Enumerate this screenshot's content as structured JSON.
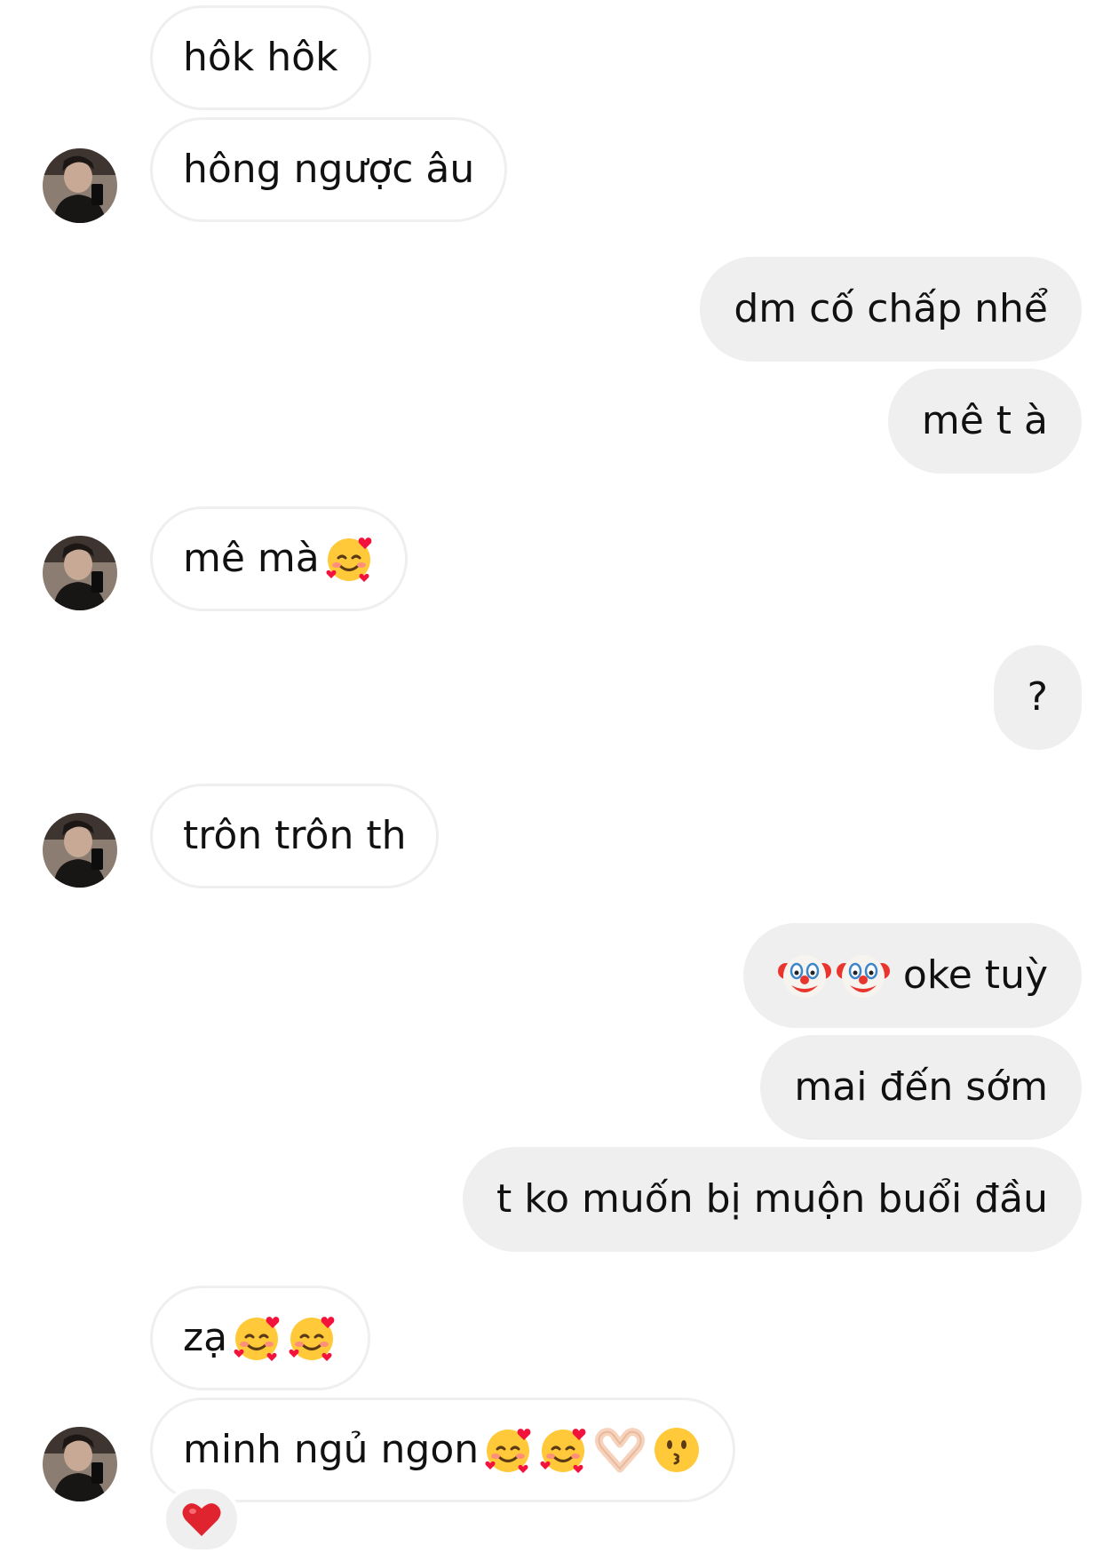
{
  "messages": [
    {
      "side": "in",
      "text": "hôk hôk",
      "emoji": []
    },
    {
      "side": "in",
      "text": "hông ngược âu",
      "emoji": []
    },
    {
      "side": "out",
      "text": "dm cố chấp nhể",
      "emoji": []
    },
    {
      "side": "out",
      "text": "mê t à",
      "emoji": []
    },
    {
      "side": "in",
      "text": "mê mà",
      "emoji": [
        "smiling-face-with-hearts-icon"
      ]
    },
    {
      "side": "out",
      "text": "?",
      "emoji": []
    },
    {
      "side": "in",
      "text": "trôn trôn th",
      "emoji": []
    },
    {
      "side": "out",
      "text": "oke tuỳ",
      "emoji": [
        "clown-face-icon",
        "clown-face-icon"
      ]
    },
    {
      "side": "out",
      "text": "mai đến sớm",
      "emoji": []
    },
    {
      "side": "out",
      "text": "t ko muốn bị muộn buổi đầu",
      "emoji": []
    },
    {
      "side": "in",
      "text": "zạ",
      "emoji": [
        "smiling-face-with-hearts-icon",
        "smiling-face-with-hearts-icon"
      ]
    },
    {
      "side": "in",
      "text": "minh ngủ ngon",
      "emoji": [
        "smiling-face-with-hearts-icon",
        "smiling-face-with-hearts-icon",
        "heart-hands-icon",
        "kissing-face-icon"
      ]
    }
  ],
  "reaction": {
    "icon": "red-heart-icon",
    "color": "#e0242f"
  },
  "colors": {
    "incoming_bg": "#ffffff",
    "incoming_border": "#efefef",
    "outgoing_bg": "#efefef",
    "text": "#111111"
  }
}
